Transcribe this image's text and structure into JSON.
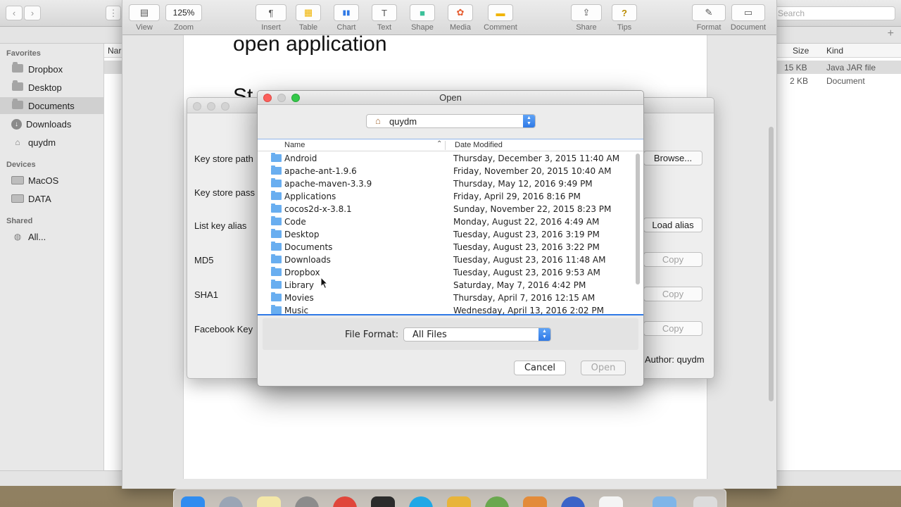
{
  "finder": {
    "search_placeholder": "Search",
    "sidebar": {
      "favorites_heading": "Favorites",
      "favorites": [
        {
          "label": "Dropbox",
          "icon": "dropbox-icon"
        },
        {
          "label": "Desktop",
          "icon": "folder-icon"
        },
        {
          "label": "Documents",
          "icon": "folder-icon",
          "selected": true
        },
        {
          "label": "Downloads",
          "icon": "downloads-icon"
        },
        {
          "label": "quydm",
          "icon": "home-icon"
        }
      ],
      "devices_heading": "Devices",
      "devices": [
        {
          "label": "MacOS",
          "icon": "disk-icon"
        },
        {
          "label": "DATA",
          "icon": "disk-icon"
        }
      ],
      "shared_heading": "Shared",
      "shared": [
        {
          "label": "All...",
          "icon": "network-icon"
        }
      ]
    },
    "columns": {
      "name": "Nar",
      "size": "Size",
      "kind": "Kind"
    },
    "rows": [
      {
        "size": "15 KB",
        "kind": "Java JAR file"
      },
      {
        "size": "2 KB",
        "kind": "Document"
      }
    ]
  },
  "pages": {
    "toolbar": [
      {
        "label": "View",
        "glyph": "▤"
      },
      {
        "label": "Zoom",
        "glyph": "125%"
      },
      {
        "label": "Insert",
        "glyph": "¶"
      },
      {
        "label": "Table",
        "glyph": "▦"
      },
      {
        "label": "Chart",
        "glyph": "▮▮"
      },
      {
        "label": "Text",
        "glyph": "T"
      },
      {
        "label": "Shape",
        "glyph": "■"
      },
      {
        "label": "Media",
        "glyph": "✿"
      },
      {
        "label": "Comment",
        "glyph": "▬"
      },
      {
        "label": "Share",
        "glyph": "⇪"
      },
      {
        "label": "Tips",
        "glyph": "?"
      },
      {
        "label": "Format",
        "glyph": "✎"
      },
      {
        "label": "Document",
        "glyph": "▭"
      }
    ],
    "doc_heading": "open application",
    "doc_partial": "St"
  },
  "keystore": {
    "labels": [
      "Key store path",
      "Key store pass",
      "List key alias",
      "MD5",
      "SHA1",
      "Facebook Key"
    ],
    "buttons": {
      "browse": "Browse...",
      "load_alias": "Load alias",
      "copy": "Copy"
    },
    "author": "Author: quydm"
  },
  "dialog": {
    "title": "Open",
    "location": "quydm",
    "columns": {
      "name": "Name",
      "date": "Date Modified"
    },
    "files": [
      {
        "name": "Android",
        "date": "Thursday, December 3, 2015 11:40 AM"
      },
      {
        "name": "apache-ant-1.9.6",
        "date": "Friday, November 20, 2015 10:40 AM"
      },
      {
        "name": "apache-maven-3.3.9",
        "date": "Thursday, May 12, 2016 9:49 PM"
      },
      {
        "name": "Applications",
        "date": "Friday, April 29, 2016 8:16 PM"
      },
      {
        "name": "cocos2d-x-3.8.1",
        "date": "Sunday, November 22, 2015 8:23 PM"
      },
      {
        "name": "Code",
        "date": "Monday, August 22, 2016 4:49 AM"
      },
      {
        "name": "Desktop",
        "date": "Tuesday, August 23, 2016 3:19 PM"
      },
      {
        "name": "Documents",
        "date": "Tuesday, August 23, 2016 3:22 PM"
      },
      {
        "name": "Downloads",
        "date": "Tuesday, August 23, 2016 11:48 AM"
      },
      {
        "name": "Dropbox",
        "date": "Tuesday, August 23, 2016 9:53 AM"
      },
      {
        "name": "Library",
        "date": "Saturday, May 7, 2016 4:42 PM"
      },
      {
        "name": "Movies",
        "date": "Thursday, April 7, 2016 12:15 AM"
      },
      {
        "name": "Music",
        "date": "Wednesday, April 13, 2016 2:02 PM"
      }
    ],
    "file_format_label": "File Format:",
    "file_format_value": "All Files",
    "cancel": "Cancel",
    "open": "Open"
  },
  "colors": {
    "accent": "#2f79e6",
    "folder": "#69aef0",
    "close": "#fc605c",
    "zoom": "#34c84a"
  }
}
